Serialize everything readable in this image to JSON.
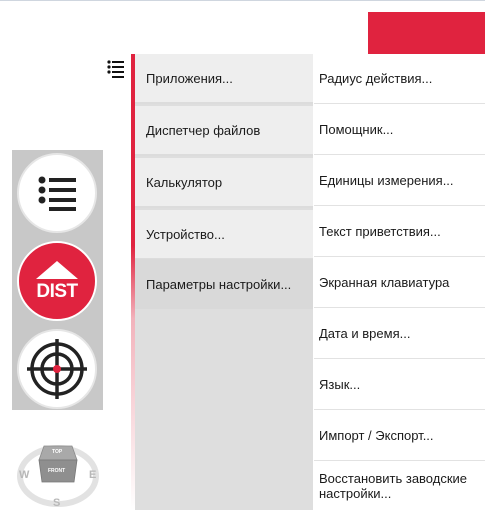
{
  "header": {
    "accent_color": "#e0233f"
  },
  "menu_toggle": {
    "icon": "list-icon"
  },
  "toolbar": {
    "buttons": [
      {
        "icon": "list-icon"
      },
      {
        "icon": "arrow-up-icon",
        "label": "DIST"
      },
      {
        "icon": "crosshair-icon"
      }
    ]
  },
  "compass": {
    "west": "W",
    "east": "E",
    "south": "S",
    "cube_top": "TOP",
    "cube_front": "FRONT"
  },
  "menu": {
    "primary": [
      {
        "label": "Приложения..."
      },
      {
        "label": "Диспетчер файлов"
      },
      {
        "label": "Калькулятор"
      },
      {
        "label": "Устройство..."
      },
      {
        "label": "Параметры настройки...",
        "selected": true
      }
    ],
    "secondary": [
      {
        "label": "Радиус действия..."
      },
      {
        "label": "Помощник..."
      },
      {
        "label": "Единицы измерения..."
      },
      {
        "label": "Текст приветствия..."
      },
      {
        "label": "Экранная клавиатура"
      },
      {
        "label": "Дата и время..."
      },
      {
        "label": "Язык..."
      },
      {
        "label": "Импорт / Экспорт..."
      },
      {
        "label": "Восстановить заводские настройки..."
      }
    ]
  }
}
